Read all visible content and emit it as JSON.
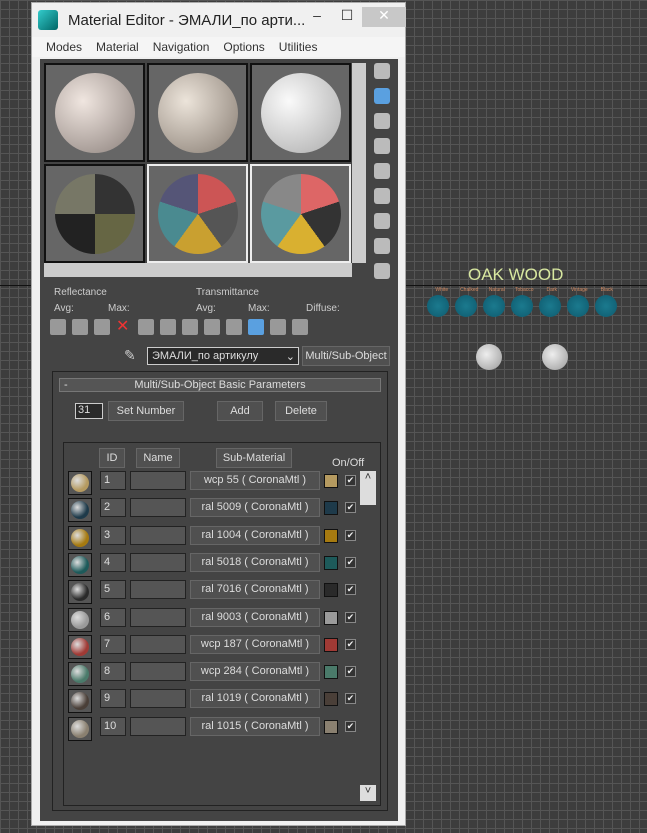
{
  "viewport": {
    "title": "OAK WOOD",
    "labels": [
      "White",
      "Chalked",
      "Natural",
      "Tobacco",
      "Dark",
      "Vintage",
      "Black"
    ]
  },
  "window": {
    "title": "Material Editor - ЭМАЛИ_по арти...",
    "minimize": "–",
    "maximize": "☐",
    "close": "✕"
  },
  "menu": [
    "Modes",
    "Material",
    "Navigation",
    "Options",
    "Utilities"
  ],
  "info": {
    "reflectance": "Reflectance",
    "avg": "Avg:",
    "max": "Max:",
    "transmittance": "Transmittance",
    "avg2": "Avg:",
    "max2": "Max:",
    "diffuse": "Diffuse:"
  },
  "material_name": "ЭМАЛИ_по артикулу",
  "material_type": "Multi/Sub-Object",
  "rollout": {
    "title": "Multi/Sub-Object Basic Parameters",
    "collapse": "-",
    "count": "31",
    "set_number": "Set Number",
    "add": "Add",
    "delete": "Delete"
  },
  "columns": {
    "id": "ID",
    "name": "Name",
    "sub": "Sub-Material",
    "onoff": "On/Off"
  },
  "rows": [
    {
      "id": "1",
      "sub": "wcp 55  ( CoronaMtl )",
      "color": "#b59a60",
      "on": true
    },
    {
      "id": "2",
      "sub": "ral 5009  ( CoronaMtl )",
      "color": "#1e3a4a",
      "on": true
    },
    {
      "id": "3",
      "sub": "ral 1004  ( CoronaMtl )",
      "color": "#a67a10",
      "on": true
    },
    {
      "id": "4",
      "sub": "ral 5018  ( CoronaMtl )",
      "color": "#1d5a5a",
      "on": true
    },
    {
      "id": "5",
      "sub": "ral 7016  ( CoronaMtl )",
      "color": "#2a2a2a",
      "on": true
    },
    {
      "id": "6",
      "sub": "ral 9003  ( CoronaMtl )",
      "color": "#9a9a9a",
      "on": true
    },
    {
      "id": "7",
      "sub": "wcp 187  ( CoronaMtl )",
      "color": "#a03a35",
      "on": true
    },
    {
      "id": "8",
      "sub": "wcp 284  ( CoronaMtl )",
      "color": "#4a7a6a",
      "on": true
    },
    {
      "id": "9",
      "sub": "ral 1019  ( CoronaMtl )",
      "color": "#4a3f38",
      "on": true
    },
    {
      "id": "10",
      "sub": "ral 1015  ( CoronaMtl )",
      "color": "#8a8070",
      "on": true
    }
  ]
}
